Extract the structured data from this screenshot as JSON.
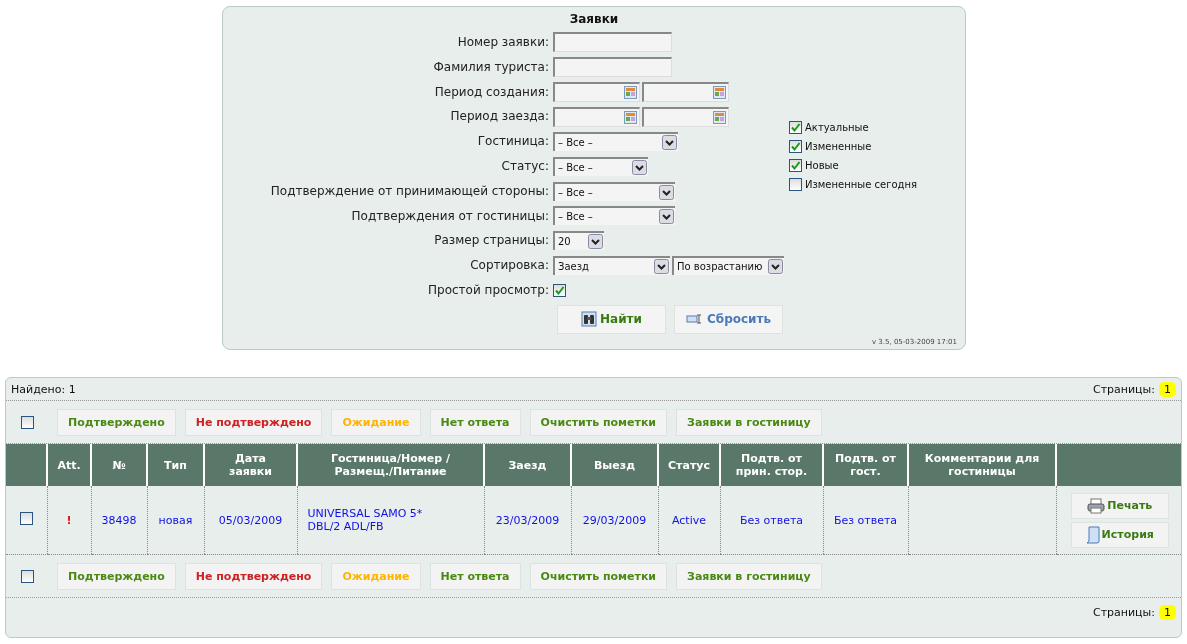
{
  "search_form": {
    "title": "Заявки",
    "fields": [
      {
        "kind": "text",
        "label": "Номер заявки:"
      },
      {
        "kind": "text",
        "label": "Фамилия туриста:"
      },
      {
        "kind": "date_range",
        "label": "Период создания:"
      },
      {
        "kind": "date_range",
        "label": "Период заезда:"
      },
      {
        "kind": "select",
        "label": "Гостиница:",
        "selects": [
          "– Все –"
        ]
      },
      {
        "kind": "select",
        "label": "Статус:",
        "selects": [
          "– Все –"
        ]
      },
      {
        "kind": "select",
        "label": "Подтверждение от принимающей стороны:",
        "selects": [
          "– Все –"
        ]
      },
      {
        "kind": "select",
        "label": "Подтверждения от гостиницы:",
        "selects": [
          "– Все –"
        ]
      },
      {
        "kind": "select",
        "label": "Размер страницы:",
        "selects": [
          "20"
        ]
      },
      {
        "kind": "select",
        "label": "Сортировка:",
        "selects": [
          "Заезд",
          "По возрастанию"
        ]
      },
      {
        "kind": "checkbox",
        "label": "Простой просмотр:",
        "checked": true
      }
    ],
    "filters": [
      {
        "label": "Актуальные",
        "checked": true
      },
      {
        "label": "Измененные",
        "checked": true
      },
      {
        "label": "Новые",
        "checked": true
      },
      {
        "label": "Измененные сегодня",
        "checked": false
      }
    ],
    "buttons": [
      {
        "kind": "search",
        "label": "Найти"
      },
      {
        "kind": "reset",
        "label": "Сбросить"
      }
    ],
    "version": "v 3.5, 05-03-2009 17:01"
  },
  "results": {
    "found": "Найдено: 1",
    "pages_top": {
      "label": "Страницы:",
      "pages": [
        {
          "label": "1",
          "selected": true
        }
      ]
    },
    "action_bar_top": {
      "checked": false,
      "actions": [
        {
          "label": "Подтверждено",
          "color": "#4a8a12"
        },
        {
          "label": "Не подтверждено",
          "color": "#cc2222"
        },
        {
          "label": "Ожидание",
          "color": "#ffb400"
        },
        {
          "label": "Нет ответа",
          "color": "#4a8a12"
        },
        {
          "label": "Очистить пометки",
          "color": "#4a8a12"
        },
        {
          "label": "Заявки в гостиницу",
          "color": "#4a8a12"
        }
      ]
    },
    "columns": [
      "Att.",
      "№",
      "Тип",
      "Дата заявки",
      "Гостиница/Номер /Размещ./Питание",
      "Заезд",
      "Выезд",
      "Статус",
      "Подтв. от прин. стор.",
      "Подтв. от гост.",
      "Комментарии для гостиницы"
    ],
    "rows": [
      {
        "checked": false,
        "att": "!",
        "number": "38498",
        "type": "новая",
        "created": "05/03/2009",
        "hotel": [
          "UNIVERSAL SAMO 5*",
          "DBL/2 ADL/FB"
        ],
        "checkin": "23/03/2009",
        "checkout": "29/03/2009",
        "status": "Active",
        "host_confirmation": "Без ответа",
        "hotel_confirmation": "Без ответа",
        "buttons": [
          {
            "kind": "print",
            "label": "Печать"
          },
          {
            "kind": "history",
            "label": "История"
          }
        ]
      }
    ],
    "action_bar_bottom": {
      "checked": false,
      "actions": [
        {
          "label": "Подтверждено",
          "color": "#4a8a12"
        },
        {
          "label": "Не подтверждено",
          "color": "#cc2222"
        },
        {
          "label": "Ожидание",
          "color": "#ffb400"
        },
        {
          "label": "Нет ответа",
          "color": "#4a8a12"
        },
        {
          "label": "Очистить пометки",
          "color": "#4a8a12"
        },
        {
          "label": "Заявки в гостиницу",
          "color": "#4a8a12"
        }
      ]
    },
    "pages_bottom": {
      "label": "Страницы:",
      "pages": [
        {
          "label": "1",
          "selected": true
        }
      ]
    }
  }
}
